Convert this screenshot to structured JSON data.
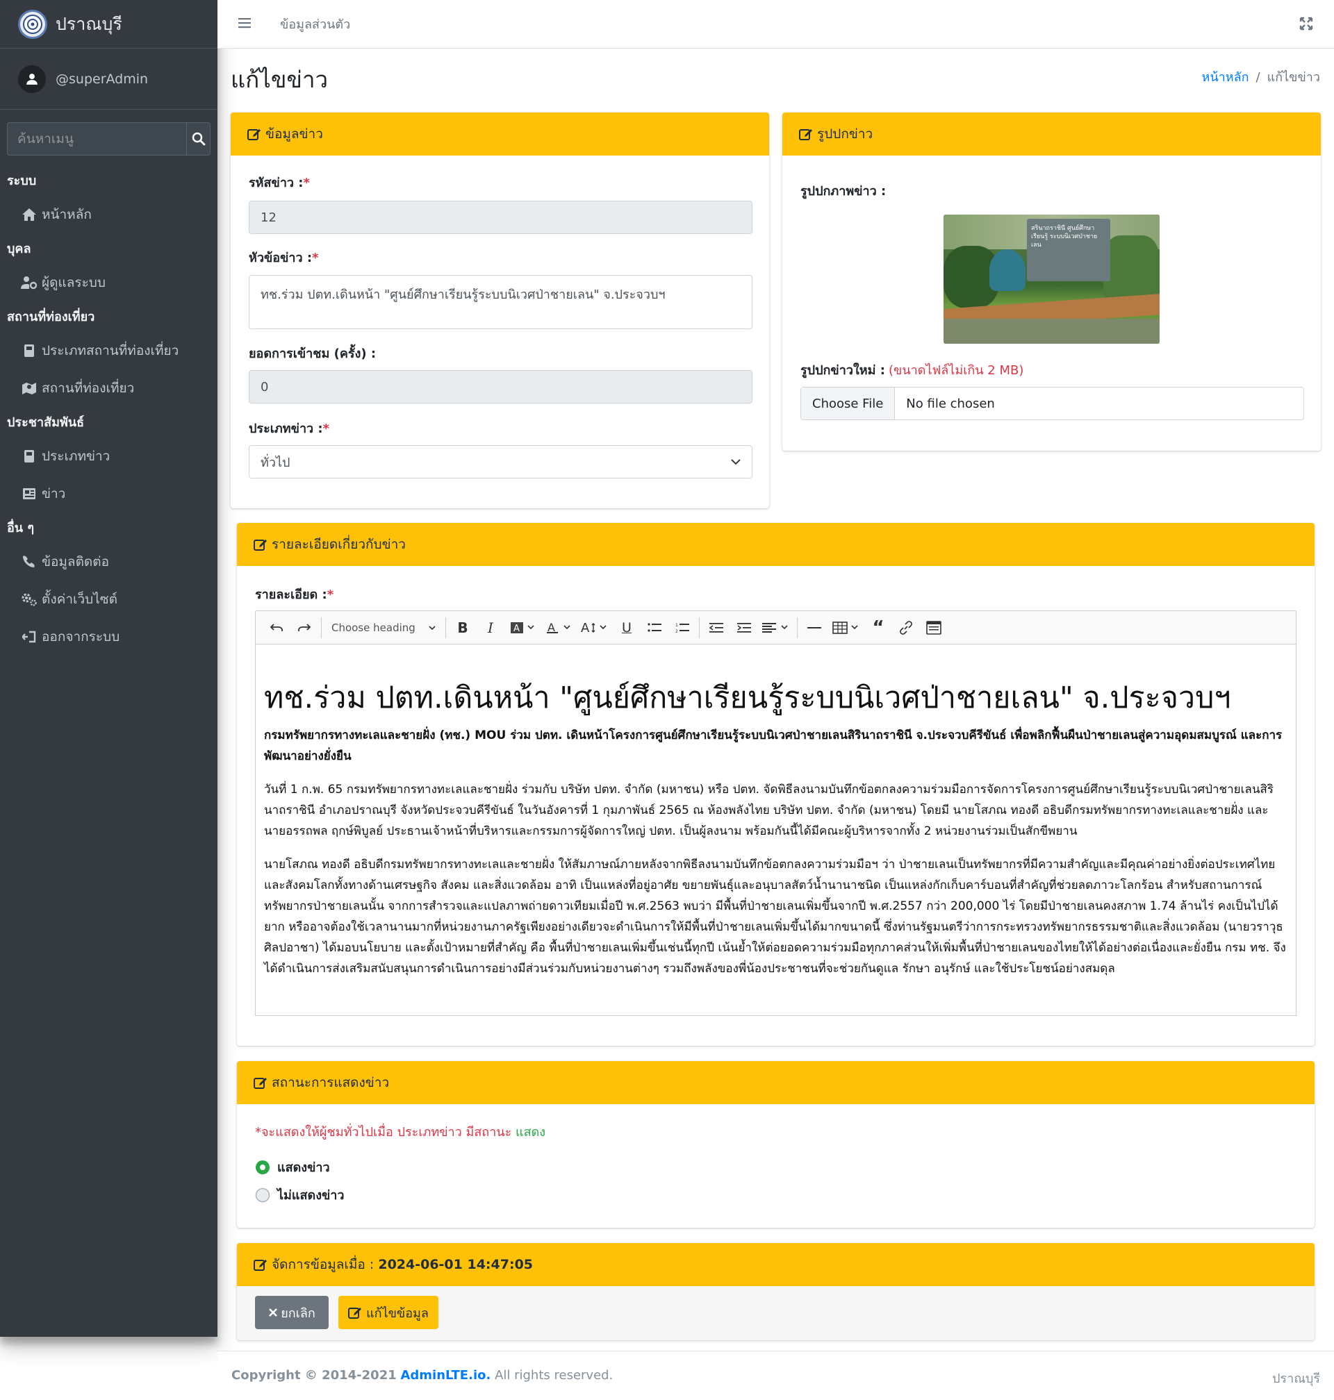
{
  "sidebar": {
    "brand": "ปราณบุรี",
    "user": "@superAdmin",
    "search_placeholder": "ค้นหาเมนู",
    "sections": [
      {
        "header": "ระบบ",
        "items": [
          {
            "label": "หน้าหลัก",
            "icon": "home-icon"
          }
        ]
      },
      {
        "header": "บุคล",
        "items": [
          {
            "label": "ผู้ดูแลระบบ",
            "icon": "user-cog-icon"
          }
        ]
      },
      {
        "header": "สถานที่ท่องเที่ยว",
        "items": [
          {
            "label": "ประเภทสถานที่ท่องเที่ยว",
            "icon": "book-icon"
          },
          {
            "label": "สถานที่ท่องเที่ยว",
            "icon": "map-icon"
          }
        ]
      },
      {
        "header": "ประชาสัมพันธ์",
        "items": [
          {
            "label": "ประเภทข่าว",
            "icon": "book-icon"
          },
          {
            "label": "ข่าว",
            "icon": "newspaper-icon"
          }
        ]
      },
      {
        "header": "อื่น ๆ",
        "items": [
          {
            "label": "ข้อมูลติดต่อ",
            "icon": "phone-icon"
          },
          {
            "label": "ตั้งค่าเว็บไซต์",
            "icon": "cogs-icon"
          },
          {
            "label": "ออกจากระบบ",
            "icon": "sign-out-icon"
          }
        ]
      }
    ]
  },
  "topbar": {
    "link": "ข้อมูลส่วนตัว"
  },
  "page": {
    "title": "แก้ไขข่าว",
    "breadcrumb_home": "หน้าหลัก",
    "breadcrumb_sep": "/",
    "breadcrumb_current": "แก้ไขข่าว"
  },
  "news_info": {
    "header": "ข้อมูลข่าว",
    "id_label": "รหัสข่าว :",
    "id_value": "12",
    "title_label": "หัวข้อข่าว :",
    "title_value": "ทช.ร่วม ปตท.เดินหน้า \"ศูนย์ศึกษาเรียนรู้ระบบนิเวศป่าชายเลน\" จ.ประจวบฯ",
    "views_label": "ยอดการเข้าชม (ครั้ง) :",
    "views_value": "0",
    "type_label": "ประเภทข่าว :",
    "type_value": "ทั่วไป",
    "required_mark": "*"
  },
  "cover": {
    "header": "รูปปกข่าว",
    "image_label": "รูปปกภาพข่าว :",
    "sign_text": "สรินาถราชินี ศูนย์ศึกษาเรียนรู้ ระบบนิเวศป่าชายเลน",
    "new_label": "รูปปกข่าวใหม่ :",
    "new_hint": "(ขนาดไฟล์ไม่เกิน 2 MB)",
    "choose_file": "Choose File",
    "no_file": "No file chosen"
  },
  "details": {
    "header": "รายละเอียดเกี่ยวกับข่าว",
    "label": "รายละเอียด :",
    "heading_select": "Choose heading",
    "heading": "ทช.ร่วม ปตท.เดินหน้า \"ศูนย์ศึกษาเรียนรู้ระบบนิเวศป่าชายเลน\" จ.ประจวบฯ",
    "lead": "กรมทรัพยากรทางทะเลและชายฝั่ง (ทช.) MOU ร่วม ปตท. เดินหน้าโครงการศูนย์ศึกษาเรียนรู้ระบบนิเวศป่าชายเลนสิรินาถราชินี จ.ประจวบคีรีขันธ์ เพื่อพลิกฟื้นผืนป่าชายเลนสู่ความอุดมสมบูรณ์ และการพัฒนาอย่างยั่งยืน",
    "p1": "วันที่ 1 ก.พ. 65 กรมทรัพยากรทางทะเลและชายฝั่ง ร่วมกับ บริษัท ปตท. จำกัด (มหาชน) หรือ ปตท. จัดพิธีลงนามบันทึกข้อตกลงความร่วมมือการจัดการโครงการศูนย์ศึกษาเรียนรู้ระบบนิเวศป่าชายเลนสิรินาถราชินี อำเภอปราณบุรี จังหวัดประจวบคีรีขันธ์ ในวันอังคารที่ 1 กุมภาพันธ์ 2565 ณ ห้องพลังไทย บริษัท ปตท. จำกัด (มหาชน) โดยมี นายโสภณ ทองดี อธิบดีกรมทรัพยากรทางทะเลและชายฝั่ง และนายอรรถพล ฤกษ์พิบูลย์ ประธานเจ้าหน้าที่บริหารและกรรมการผู้จัดการใหญ่ ปตท. เป็นผู้ลงนาม พร้อมกันนี้ได้มีคณะผู้บริหารจากทั้ง 2 หน่วยงานร่วมเป็นสักขีพยาน",
    "p2": "นายโสภณ ทองดี อธิบดีกรมทรัพยากรทางทะเลและชายฝั่ง ให้สัมภาษณ์ภายหลังจากพิธีลงนามบันทึกข้อตกลงความร่วมมือฯ ว่า ป่าชายเลนเป็นทรัพยากรที่มีความสำคัญและมีคุณค่าอย่างยิ่งต่อประเทศไทยและสังคมโลกทั้งทางด้านเศรษฐกิจ สังคม และสิ่งแวดล้อม อาทิ เป็นแหล่งที่อยู่อาศัย ขยายพันธุ์และอนุบาลสัตว์น้ำนานาชนิด เป็นแหล่งกักเก็บคาร์บอนที่สำคัญที่ช่วยลดภาวะโลกร้อน สำหรับสถานการณ์ทรัพยากรป่าชายเลนนั้น จากการสำรวจและแปลภาพถ่ายดาวเทียมเมื่อปี พ.ศ.2563 พบว่า มีพื้นที่ป่าชายเลนเพิ่มขึ้นจากปี พ.ศ.2557 กว่า 200,000 ไร่ โดยมีป่าชายเลนคงสภาพ 1.74 ล้านไร่ คงเป็นไปได้ยาก หรืออาจต้องใช้เวลานานมากที่หน่วยงานภาครัฐเพียงอย่างเดียวจะดำเนินการให้มีพื้นที่ป่าชายเลนเพิ่มขึ้นได้มากขนาดนี้ ซึ่งท่านรัฐมนตรีว่าการกระทรวงทรัพยากรธรรมชาติและสิ่งแวดล้อม (นายวราวุธ ศิลปอาชา) ได้มอบนโยบาย และตั้งเป้าหมายที่สำคัญ คือ พื้นที่ป่าชายเลนเพิ่มขึ้นเช่นนี้ทุกปี เน้นย้ำให้ต่อยอดความร่วมมือทุกภาคส่วนให้เพิ่มพื้นที่ป่าชายเลนของไทยให้ได้อย่างต่อเนื่องและยั่งยืน กรม ทช. จึงได้ดำเนินการส่งเสริมสนับสนุนการดำเนินการอย่างมีส่วนร่วมกับหน่วยงานต่างๆ รวมถึงพลังของพี่น้องประชาชนที่จะช่วยกันดูแล รักษา อนุรักษ์ และใช้ประโยชน์อย่างสมดุล"
  },
  "status": {
    "header": "สถานะการแสดงข่าว",
    "note_prefix": "*จะแสดงให้ผู้ชมทั่วไปเมื่อ ประเภทข่าว มีสถานะ",
    "note_status": "แสดง",
    "show_label": "แสดงข่าว",
    "hide_label": "ไม่แสดงข่าว",
    "selected": "แสดงข่าว"
  },
  "manage": {
    "header_prefix": "จัดการข้อมูลเมื่อ :",
    "timestamp": "2024-06-01 14:47:05",
    "cancel": "ยกเลิก",
    "save": "แก้ไขข้อมูล"
  },
  "footer": {
    "copyright": "Copyright © 2014-2021",
    "brand_link": "AdminLTE.io.",
    "rights": "All rights reserved.",
    "right": "ปราณบุรี"
  },
  "colors": {
    "accent": "#ffc107",
    "sidebar": "#343a40",
    "link": "#007bff",
    "danger": "#dc3545",
    "success": "#28a745",
    "secondary": "#6c757d"
  }
}
